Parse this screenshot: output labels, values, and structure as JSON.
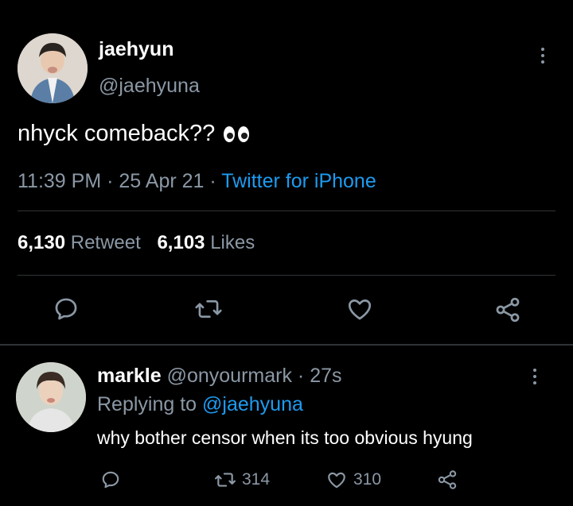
{
  "main_tweet": {
    "display_name": "jaehyun",
    "handle": "@jaehyuna",
    "text": "nhyck comeback??",
    "emoji": "👀",
    "time": "11:39 PM",
    "date": "25 Apr 21",
    "source": "Twitter for iPhone",
    "separator": "·",
    "retweet_count": "6,130",
    "retweet_label": "Retweet",
    "like_count": "6,103",
    "like_label": "Likes"
  },
  "reply": {
    "display_name": "markle",
    "handle": "@onyourmark",
    "separator": "·",
    "time_ago": "27s",
    "replying_to_label": "Replying to",
    "replying_to_handle": "@jaehyuna",
    "text": "why bother censor when its too obvious hyung",
    "retweet_count": "314",
    "like_count": "310"
  },
  "colors": {
    "background": "#000000",
    "muted": "#8b98a5",
    "link": "#1d9bf0",
    "divider": "#2f3336"
  }
}
